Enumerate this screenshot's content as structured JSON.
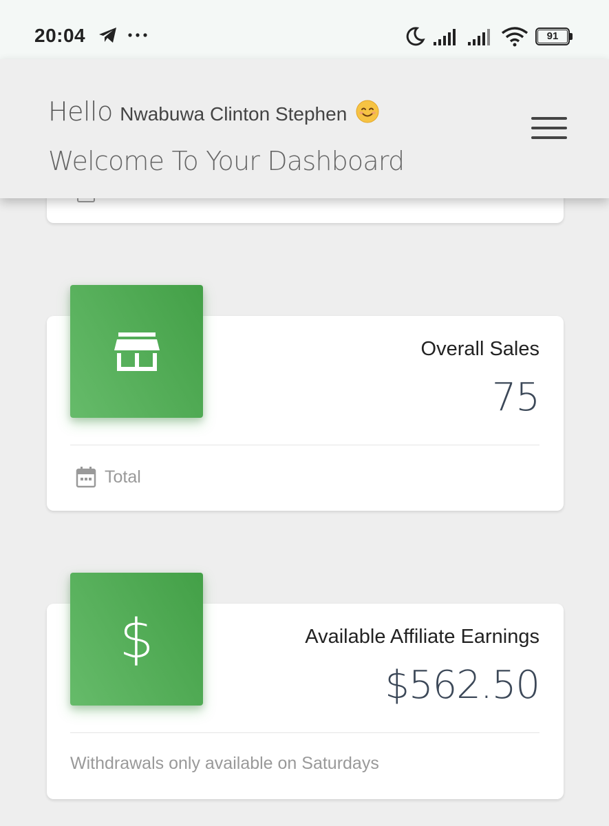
{
  "status_bar": {
    "time": "20:04",
    "left_icons": [
      "telegram-icon",
      "more-dots-icon"
    ],
    "right_icons": [
      "moon-icon",
      "signal-icon",
      "signal-icon",
      "wifi-icon",
      "battery-icon"
    ],
    "battery_level": "91"
  },
  "header": {
    "hello": "Hello",
    "name": "Nwabuwa Clinton Stephen",
    "emoji": "smiling-face-icon",
    "welcome": "Welcome To Your Dashboard",
    "menu_icon": "hamburger-menu-icon"
  },
  "cards": [
    {
      "icon": "store-icon",
      "category": "Overall Sales",
      "value": "75",
      "footer": "Total",
      "footer_icon": "calendar-icon"
    },
    {
      "icon": "dollar-icon",
      "icon_glyph": "$",
      "category": "Available Affiliate Earnings",
      "value": "$562.50",
      "footer": "Withdrawals only available on Saturdays"
    }
  ],
  "colors": {
    "accent_green": "#4caf50",
    "background": "#eeeeee",
    "card": "#ffffff",
    "value_text": "#3c4858"
  }
}
